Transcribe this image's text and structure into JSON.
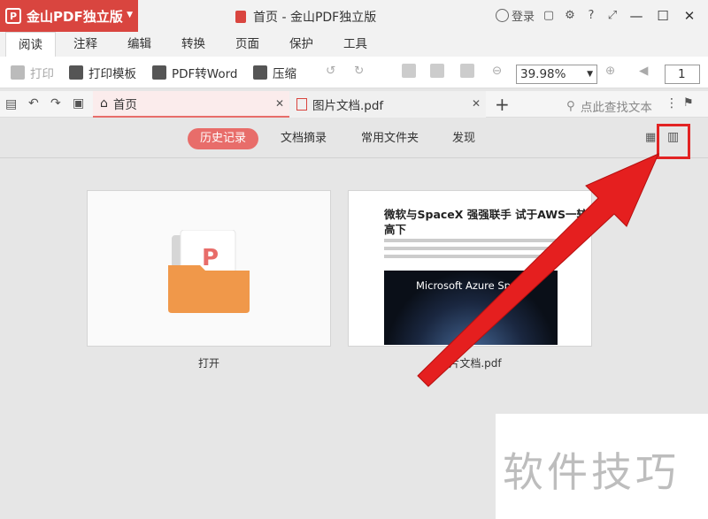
{
  "app": {
    "brand": "金山PDF独立版",
    "window_title": "首页 - 金山PDF独立版",
    "login": "登录"
  },
  "menu": [
    "阅读",
    "注释",
    "编辑",
    "转换",
    "页面",
    "保护",
    "工具"
  ],
  "toolbar": {
    "print": "打印",
    "print_template": "打印模板",
    "pdf_to_word": "PDF转Word",
    "compress": "压缩",
    "zoom": "39.98%",
    "page": "1"
  },
  "doc_tabs": {
    "home": "首页",
    "pdf": "图片文档.pdf",
    "search_placeholder": "点此查找文本"
  },
  "nav": {
    "history": "历史记录",
    "digest": "文档摘录",
    "folders": "常用文件夹",
    "discover": "发现"
  },
  "cards": {
    "open_label": "打开",
    "pdf_label": "图片文档.pdf",
    "thumb_title_1": "微软与SpaceX 强强联手 试于AWS一较",
    "thumb_title_2": "高下",
    "thumb_image_text": "Microsoft Azure Space"
  },
  "watermark": "软件技巧"
}
